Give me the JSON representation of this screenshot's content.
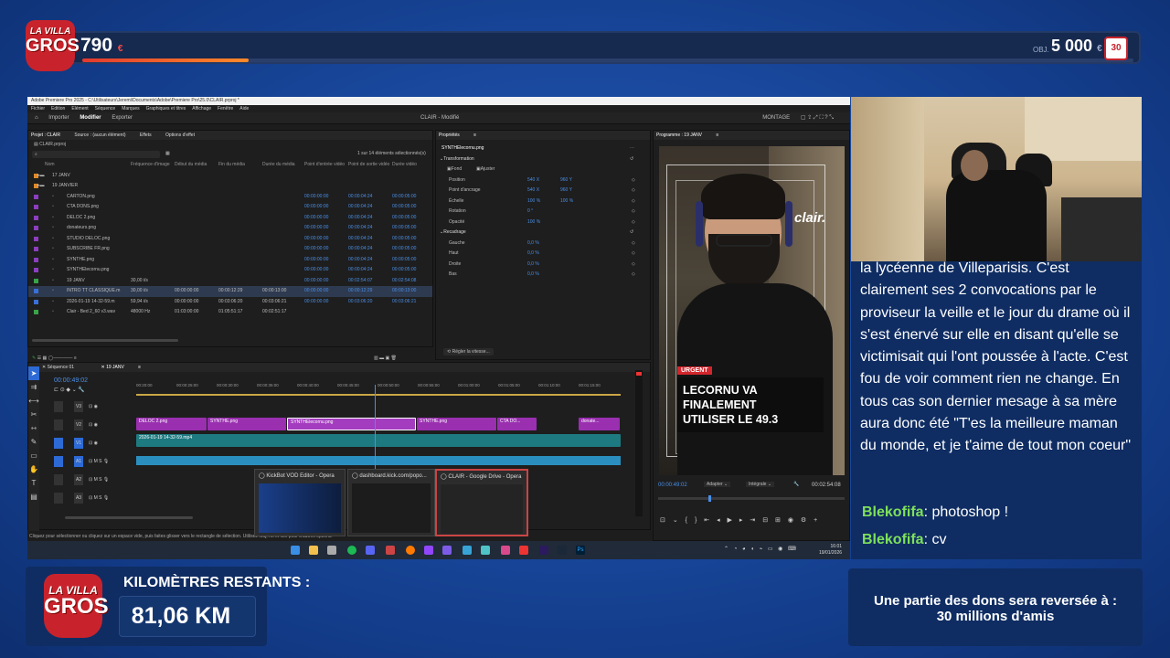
{
  "top_bar": {
    "logo_line1": "LA VILLA",
    "logo_line2": "GROS",
    "amount": "790",
    "amount_currency": "€",
    "goal_label": "OBJ.",
    "goal": "5 000",
    "goal_currency": "€",
    "badge": "30",
    "progress_fraction": 0.158
  },
  "premiere": {
    "window_title": "Adobe Premiere Pro 2025 - C:\\Utilisateurs\\Jeremi\\Documents\\Adobe\\Premiere Pro\\25.0\\CLAIR.prproj *",
    "menu": [
      "Fichier",
      "Edition",
      "Elément",
      "Séquence",
      "Marques",
      "Graphiques et titres",
      "Affichage",
      "Fenêtre",
      "Aide"
    ],
    "workspace_tabs": [
      "Importer",
      "Modifier",
      "Exporter"
    ],
    "project_title": "CLAIR - Modifié",
    "montage_label": "MONTAGE",
    "project_panel": {
      "tabs": [
        "Projet : CLAIR",
        "Source : (aucun élément)",
        "Effets",
        "Options d'effet"
      ],
      "file": "CLAIR.prproj",
      "selection_info": "1 sur 14 éléments sélectionnés(s)",
      "columns": [
        "Nom",
        "Fréquence d'image",
        "Début du média",
        "Fin du média",
        "Durée du média",
        "Point d'entrée vidéo",
        "Point de sortie vidéo",
        "Durée vidéo"
      ],
      "rows": [
        {
          "name": "17 JANV",
          "color": "#e08a2c",
          "c": [
            "",
            "",
            "",
            "",
            "",
            "",
            ""
          ]
        },
        {
          "name": "19 JANVIER",
          "color": "#e08a2c",
          "c": [
            "",
            "",
            "",
            "",
            "",
            "",
            ""
          ]
        },
        {
          "name": "CARTON.png",
          "color": "#8b3fbf",
          "c": [
            "",
            "",
            "",
            "",
            "00:00:00:00",
            "00:00:04:24",
            "00:00:05:00"
          ]
        },
        {
          "name": "CTA DONS.png",
          "color": "#8b3fbf",
          "c": [
            "",
            "",
            "",
            "",
            "00:00:00:00",
            "00:00:04:24",
            "00:00:05:00"
          ]
        },
        {
          "name": "DELOC 2.png",
          "color": "#8b3fbf",
          "c": [
            "",
            "",
            "",
            "",
            "00:00:00:00",
            "00:00:04:24",
            "00:00:05:00"
          ]
        },
        {
          "name": "donateurs.png",
          "color": "#8b3fbf",
          "c": [
            "",
            "",
            "",
            "",
            "00:00:00:00",
            "00:00:04:24",
            "00:00:05:00"
          ]
        },
        {
          "name": "STUDIO DELOC.png",
          "color": "#8b3fbf",
          "c": [
            "",
            "",
            "",
            "",
            "00:00:00:00",
            "00:00:04:24",
            "00:00:05:00"
          ]
        },
        {
          "name": "SUBSCRIBE FR.png",
          "color": "#8b3fbf",
          "c": [
            "",
            "",
            "",
            "",
            "00:00:00:00",
            "00:00:04:24",
            "00:00:05:00"
          ]
        },
        {
          "name": "SYNTHE.png",
          "color": "#8b3fbf",
          "c": [
            "",
            "",
            "",
            "",
            "00:00:00:00",
            "00:00:04:24",
            "00:00:05:00"
          ]
        },
        {
          "name": "SYNTHElecornu.png",
          "color": "#8b3fbf",
          "c": [
            "",
            "",
            "",
            "",
            "00:00:00:00",
            "00:00:04:24",
            "00:00:05:00"
          ]
        },
        {
          "name": "19 JANV",
          "color": "#3aa34a",
          "c": [
            "30,00 i/s",
            "",
            "",
            "",
            "00:00:00:00",
            "00:02:54:07",
            "00:02:54:08"
          ]
        },
        {
          "name": "INTRO TT CLASSIQUE.m",
          "color": "#3a6fd6",
          "c": [
            "30,00 i/s",
            "00:00:00:00",
            "00:00:12:29",
            "00:00:13:00",
            "00:00:00:00",
            "00:00:12:29",
            "00:00:13:00"
          ]
        },
        {
          "name": "2026-01-19 14-32-59.m",
          "color": "#3a6fd6",
          "c": [
            "59,94 i/s",
            "00:00:00:00",
            "00:03:06:20",
            "00:03:06:21",
            "00:00:00:00",
            "00:03:06:20",
            "00:03:06:21"
          ]
        },
        {
          "name": "Clair - Bed 2_60 v3.wav",
          "color": "#3aa34a",
          "c": [
            "48000 Hz",
            "01:03:00:00",
            "01:05:51:17",
            "00:02:51:17",
            "",
            "",
            ""
          ]
        }
      ]
    },
    "properties_panel": {
      "tab": "Propriétés",
      "file": "SYNTHElecornu.png",
      "section_transform": "Transformation",
      "fond_label": "Fond",
      "ajuster_label": "Ajuster",
      "rows": [
        {
          "label": "Position",
          "v1": "540 X",
          "v2": "960 Y"
        },
        {
          "label": "Point d'ancrage",
          "v1": "540 X",
          "v2": "960 Y"
        },
        {
          "label": "Échelle",
          "v1": "100 %",
          "v2": "100 %"
        },
        {
          "label": "Rotation",
          "v1": "0 °",
          "v2": ""
        },
        {
          "label": "Opacité",
          "v1": "100 %",
          "v2": ""
        }
      ],
      "section_crop": "Recadrage",
      "crop_rows": [
        {
          "label": "Gauche",
          "v1": "0,0 %"
        },
        {
          "label": "Haut",
          "v1": "0,0 %"
        },
        {
          "label": "Droite",
          "v1": "0,0 %"
        },
        {
          "label": "Bas",
          "v1": "0,0 %"
        }
      ],
      "speed_button": "Régler la vitesse..."
    },
    "program_monitor": {
      "tab": "Programme : 19 JANV",
      "overlay_brand": "clair.",
      "urgent_label": "URGENT",
      "headline_line1": "LECORNU VA FINALEMENT",
      "headline_line2": "UTILISER LE 49.3",
      "timecode": "00:00:49:02",
      "fit": "Adapter",
      "quality": "Intégrale",
      "duration": "00:02:54:08"
    },
    "timeline": {
      "tabs": [
        "Séquence 01",
        "19 JANV"
      ],
      "timecode": "00:00:49:02",
      "ruler": [
        "00:20:00",
        "00:00:25:00",
        "00:00:30:00",
        "00:00:35:00",
        "00:00:40:00",
        "00:00:45:00",
        "00:00:50:00",
        "00:00:55:00",
        "00:01:00:00",
        "00:01:05:00",
        "00:01:10:00",
        "00:01:15:00"
      ],
      "tracks": [
        "V3",
        "V2",
        "V1",
        "A1",
        "A2",
        "A3"
      ],
      "clips_v2": [
        "DELOC 2.png",
        "SYNTHE.png",
        "SYNTHElecornu.png",
        "SYNTHE.png",
        "CTA DO...",
        "donate..."
      ],
      "clip_v1": "2026-01-19 14-32-59.mp4"
    },
    "status_bar": "Cliquez pour sélectionner ou cliquez sur un espace vide, puis faites glisser vers le rectangle de sélection. Utilisez Maj, Alt et Ctrl pour d'autres options.",
    "task_switcher": [
      "KickBot VOD Editor - Opera",
      "dashboard.kick.com/popo...",
      "CLAIR - Google Drive - Opera"
    ],
    "clock_time": "16:01",
    "clock_date": "19/01/2026"
  },
  "chat": {
    "message": "la lycéenne de Villeparisis. C'est clairement ses 2 convocations par le proviseur la veille et le jour du drame où il s'est énervé sur elle en disant qu'elle se victimisait qui l'ont poussée à l'acte. C'est fou de voir comment rien ne change. En tous cas son dernier mesage à sa mère aura donc été \"T'es la meilleure maman du monde, et je t'aime de tout mon coeur\"",
    "entries": [
      {
        "user": "Blekofifa",
        "text": "photoshop !"
      },
      {
        "user": "Blekofifa",
        "text": "cv"
      }
    ]
  },
  "km_panel": {
    "logo_line1": "LA VILLA",
    "logo_line2": "GROS",
    "label": "KILOMÈTRES RESTANTS :",
    "value": "81,06 KM"
  },
  "donation_panel": {
    "line1": "Une partie des dons sera reversée à :",
    "line2": "30 millions d'amis"
  },
  "colors": {
    "background": "#1a4aa0",
    "panel": "#0f2d63",
    "accent_red": "#c8232c",
    "chat_user": "#7ee05a",
    "clip_purple": "#9a2fb0",
    "clip_teal": "#1d7a80",
    "audio_blue": "#2a8fbf"
  }
}
